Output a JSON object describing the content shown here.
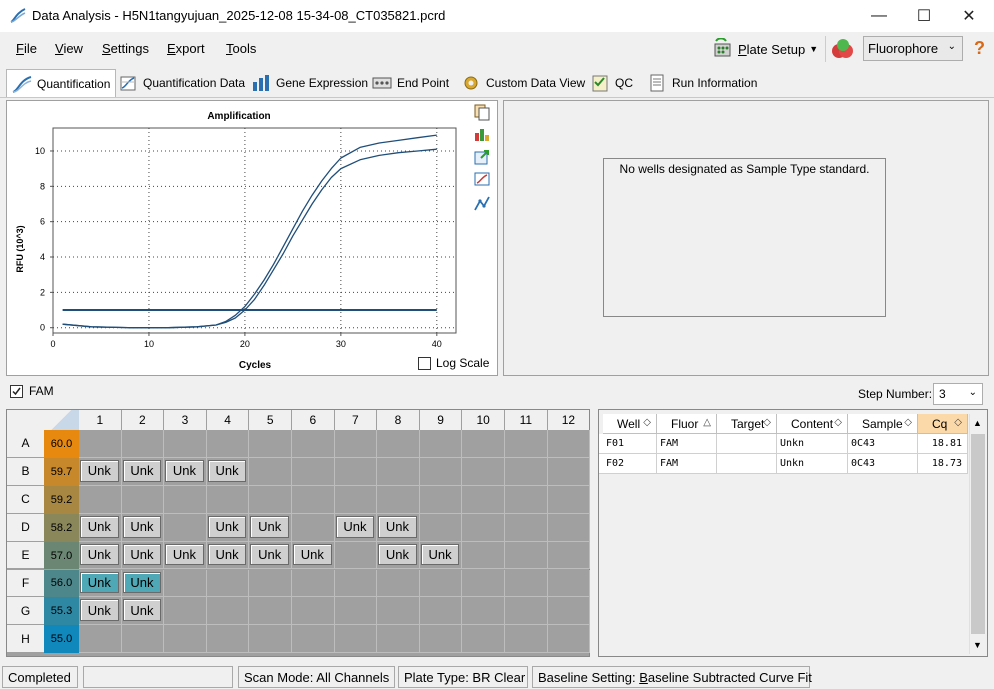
{
  "window": {
    "title": "Data Analysis - H5N1tangyujuan_2025-12-08 15-34-08_CT035821.pcrd"
  },
  "menu": [
    {
      "key": "F",
      "rest": "ile"
    },
    {
      "key": "V",
      "rest": "iew"
    },
    {
      "key": "S",
      "rest": "ettings"
    },
    {
      "key": "E",
      "rest": "xport"
    },
    {
      "key": "T",
      "rest": "ools"
    }
  ],
  "toolbar": {
    "plate_setup_key": "P",
    "plate_setup_rest": "late Setup",
    "fluorophore": "Fluorophore",
    "help": "?"
  },
  "tabs": [
    "Quantification",
    "Quantification Data",
    "Gene Expression",
    "End Point",
    "Custom Data View",
    "QC",
    "Run Information"
  ],
  "chart_data": {
    "type": "line",
    "title": "Amplification",
    "xlabel": "Cycles",
    "ylabel": "RFU (10^3)",
    "xlim": [
      0,
      42
    ],
    "ylim": [
      -0.3,
      11.3
    ],
    "xticks": [
      0,
      10,
      20,
      30,
      40
    ],
    "yticks": [
      0,
      2,
      4,
      6,
      8,
      10
    ],
    "grid": true,
    "series": [
      {
        "x": [
          1,
          4,
          8,
          12,
          15,
          17,
          18,
          19,
          20,
          21,
          22,
          23,
          24,
          25,
          26,
          27,
          28,
          29,
          30,
          32,
          34,
          36,
          38,
          40
        ],
        "y": [
          0.2,
          0.05,
          0.0,
          0.0,
          0.05,
          0.15,
          0.35,
          0.7,
          1.2,
          1.9,
          2.7,
          3.6,
          4.6,
          5.6,
          6.6,
          7.5,
          8.3,
          9.0,
          9.6,
          10.2,
          10.45,
          10.6,
          10.75,
          10.9
        ]
      },
      {
        "x": [
          1,
          4,
          8,
          12,
          15,
          17,
          18,
          19,
          20,
          21,
          22,
          23,
          24,
          25,
          26,
          27,
          28,
          29,
          30,
          32,
          34,
          36,
          38,
          40
        ],
        "y": [
          0.2,
          0.05,
          0.0,
          0.0,
          0.05,
          0.15,
          0.3,
          0.55,
          1.0,
          1.6,
          2.4,
          3.3,
          4.2,
          5.2,
          6.1,
          7.0,
          7.8,
          8.5,
          9.0,
          9.5,
          9.75,
          9.9,
          10.0,
          10.1
        ]
      },
      {
        "x": [
          1,
          40
        ],
        "y": [
          1.0,
          1.0
        ]
      }
    ],
    "log_scale_label": "Log Scale",
    "log_scale_checked": false
  },
  "standard_message": "No wells designated as Sample Type standard.",
  "fluor_filter": {
    "label": "FAM",
    "checked": true
  },
  "step": {
    "label": "Step Number:",
    "value": "3"
  },
  "plate": {
    "columns": [
      "1",
      "2",
      "3",
      "4",
      "5",
      "6",
      "7",
      "8",
      "9",
      "10",
      "11",
      "12"
    ],
    "rows": [
      {
        "label": "A",
        "temp": "60.0",
        "temp_color": "#e8890f",
        "wells": [
          "",
          "",
          "",
          "",
          "",
          "",
          "",
          "",
          "",
          "",
          "",
          ""
        ]
      },
      {
        "label": "B",
        "temp": "59.7",
        "temp_color": "#c6882b",
        "wells": [
          "Unk",
          "Unk",
          "Unk",
          "Unk",
          "",
          "",
          "",
          "",
          "",
          "",
          "",
          ""
        ]
      },
      {
        "label": "C",
        "temp": "59.2",
        "temp_color": "#a88743",
        "wells": [
          "",
          "",
          "",
          "",
          "",
          "",
          "",
          "",
          "",
          "",
          "",
          ""
        ]
      },
      {
        "label": "D",
        "temp": "58.2",
        "temp_color": "#8a875b",
        "wells": [
          "Unk",
          "Unk",
          "",
          "Unk",
          "Unk",
          "",
          "Unk",
          "Unk",
          "",
          "",
          "",
          ""
        ]
      },
      {
        "label": "E",
        "temp": "57.0",
        "temp_color": "#6b8773",
        "wells": [
          "Unk",
          "Unk",
          "Unk",
          "Unk",
          "Unk",
          "Unk",
          "",
          "Unk",
          "Unk",
          "",
          "",
          ""
        ]
      },
      {
        "label": "F",
        "temp": "56.0",
        "temp_color": "#4d878b",
        "wells": [
          "Unk",
          "Unk",
          "",
          "",
          "",
          "",
          "",
          "",
          "",
          "",
          "",
          ""
        ],
        "selected": [
          0,
          1
        ]
      },
      {
        "label": "G",
        "temp": "55.3",
        "temp_color": "#2f88a3",
        "wells": [
          "Unk",
          "Unk",
          "",
          "",
          "",
          "",
          "",
          "",
          "",
          "",
          "",
          ""
        ]
      },
      {
        "label": "H",
        "temp": "55.0",
        "temp_color": "#1188bb",
        "wells": [
          "",
          "",
          "",
          "",
          "",
          "",
          "",
          "",
          "",
          "",
          "",
          ""
        ]
      }
    ]
  },
  "table": {
    "headers": [
      "Well",
      "Fluor",
      "Target",
      "Content",
      "Sample",
      "Cq"
    ],
    "rows": [
      [
        "F01",
        "FAM",
        "",
        "Unkn",
        "0C43",
        "18.81"
      ],
      [
        "F02",
        "FAM",
        "",
        "Unkn",
        "0C43",
        "18.73"
      ]
    ]
  },
  "status": {
    "state": "Completed",
    "scan_mode": "Scan Mode: All Channels",
    "plate_type": "Plate Type: BR Clear",
    "baseline_prefix": "Baseline Setting: ",
    "baseline_key": "B",
    "baseline_rest": "aseline Subtracted Curve Fit"
  }
}
